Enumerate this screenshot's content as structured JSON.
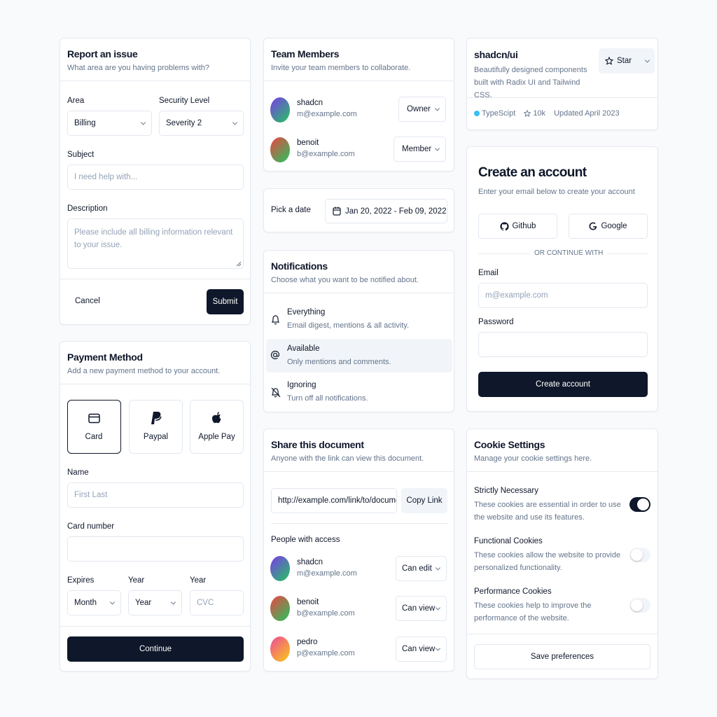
{
  "colors": {
    "primary": "#0f172a",
    "muted": "#64748b",
    "border": "#e2e8f0",
    "bg": "#f8fafc",
    "accent_bg": "#f1f5f9",
    "typescript_dot": "#38bdf8"
  },
  "report": {
    "title": "Report an issue",
    "subtitle": "What area are you having problems with?",
    "area_label": "Area",
    "area_value": "Billing",
    "security_label": "Security Level",
    "security_value": "Severity 2",
    "subject_label": "Subject",
    "subject_placeholder": "I need help with...",
    "description_label": "Description",
    "description_placeholder": "Please include all billing information relevant to your issue.",
    "cancel": "Cancel",
    "submit": "Submit"
  },
  "payment": {
    "title": "Payment Method",
    "subtitle": "Add a new payment method to your account.",
    "methods": [
      {
        "label": "Card",
        "icon": "credit-card-icon",
        "selected": true
      },
      {
        "label": "Paypal",
        "icon": "paypal-icon",
        "selected": false
      },
      {
        "label": "Apple Pay",
        "icon": "apple-icon",
        "selected": false
      }
    ],
    "name_label": "Name",
    "name_placeholder": "First Last",
    "card_label": "Card number",
    "card_value": "",
    "expires_label": "Expires",
    "month_value": "Month",
    "year_label": "Year",
    "year_value": "Year",
    "cvc_label": "Year",
    "cvc_placeholder": "CVC",
    "continue": "Continue"
  },
  "team": {
    "title": "Team Members",
    "subtitle": "Invite your team members to collaborate.",
    "members": [
      {
        "name": "shadcn",
        "email": "m@example.com",
        "role": "Owner"
      },
      {
        "name": "benoit",
        "email": "b@example.com",
        "role": "Member"
      }
    ]
  },
  "datepicker": {
    "label": "Pick a date",
    "value": "Jan 20, 2022 - Feb 09, 2022"
  },
  "notifications": {
    "title": "Notifications",
    "subtitle": "Choose what you want to be notified about.",
    "items": [
      {
        "title": "Everything",
        "desc": "Email digest, mentions & all activity.",
        "icon": "bell-icon",
        "active": false
      },
      {
        "title": "Available",
        "desc": "Only mentions and comments.",
        "icon": "at-sign-icon",
        "active": true
      },
      {
        "title": "Ignoring",
        "desc": "Turn off all notifications.",
        "icon": "bell-off-icon",
        "active": false
      }
    ]
  },
  "share": {
    "title": "Share this document",
    "subtitle": "Anyone with the link can view this document.",
    "link": "http://example.com/link/to/document",
    "copy": "Copy Link",
    "people_label": "People with access",
    "people": [
      {
        "name": "shadcn",
        "email": "m@example.com",
        "perm": "Can edit"
      },
      {
        "name": "benoit",
        "email": "b@example.com",
        "perm": "Can view"
      },
      {
        "name": "pedro",
        "email": "p@example.com",
        "perm": "Can view"
      }
    ]
  },
  "repo": {
    "title": "shadcn/ui",
    "description": "Beautifully designed components built with Radix UI and Tailwind CSS.",
    "star": "Star",
    "language": "TypeScipt",
    "stars": "10k",
    "updated": "Updated April 2023"
  },
  "account": {
    "title": "Create an account",
    "subtitle": "Enter your email below to create your account",
    "github": "Github",
    "google": "Google",
    "divider": "OR CONTINUE WITH",
    "email_label": "Email",
    "email_placeholder": "m@example.com",
    "password_label": "Password",
    "submit": "Create account"
  },
  "cookies": {
    "title": "Cookie Settings",
    "subtitle": "Manage your cookie settings here.",
    "items": [
      {
        "title": "Strictly Necessary",
        "desc": "These cookies are essential in order to use the website and use its features.",
        "on": true
      },
      {
        "title": "Functional Cookies",
        "desc": "These cookies allow the website to provide personalized functionality.",
        "on": false
      },
      {
        "title": "Performance Cookies",
        "desc": "These cookies help to improve the performance of the website.",
        "on": false
      }
    ],
    "save": "Save preferences"
  }
}
